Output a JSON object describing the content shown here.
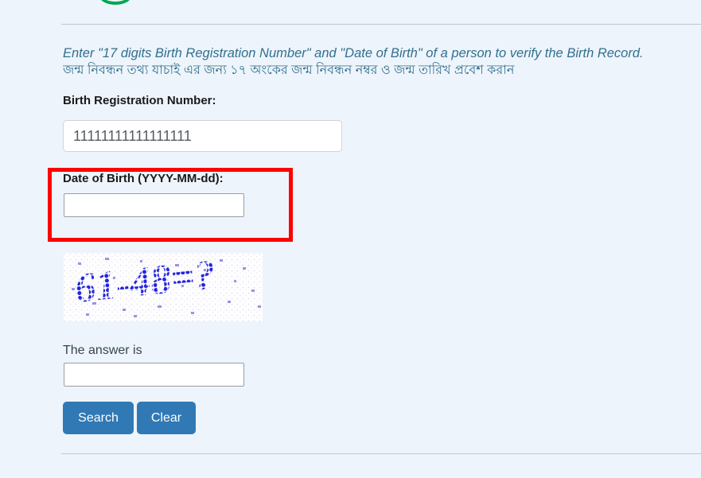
{
  "page": {
    "background_color": "#eef4fb",
    "divider_color": "#c3c7cb"
  },
  "logo": {
    "name": "site-logo-partial",
    "color": "#00a651"
  },
  "instructions": {
    "english": "Enter \"17 digits Birth Registration Number\" and \"Date of Birth\" of a person to verify the Birth Record.",
    "bangla": "জন্ম নিবন্ধন তথ্য যাচাই এর জন্য ১৭ অংকের জন্ম নিবন্ধন নম্বর ও জন্ম তারিখ প্রবেশ করান",
    "color": "#31708f"
  },
  "form": {
    "birth_registration": {
      "label": "Birth Registration Number:",
      "value": "11111111111111111",
      "placeholder": ""
    },
    "date_of_birth": {
      "label": "Date of Birth (YYYY-MM-dd):",
      "value": "",
      "placeholder": "",
      "highlight_color": "#ff0000"
    },
    "captcha": {
      "text": "61-48=?",
      "ink_color": "#2222dd",
      "alt": "captcha arithmetic challenge"
    },
    "answer": {
      "label": "The answer is",
      "value": "",
      "placeholder": ""
    }
  },
  "buttons": {
    "search": "Search",
    "clear": "Clear",
    "color": "#3079b5"
  }
}
